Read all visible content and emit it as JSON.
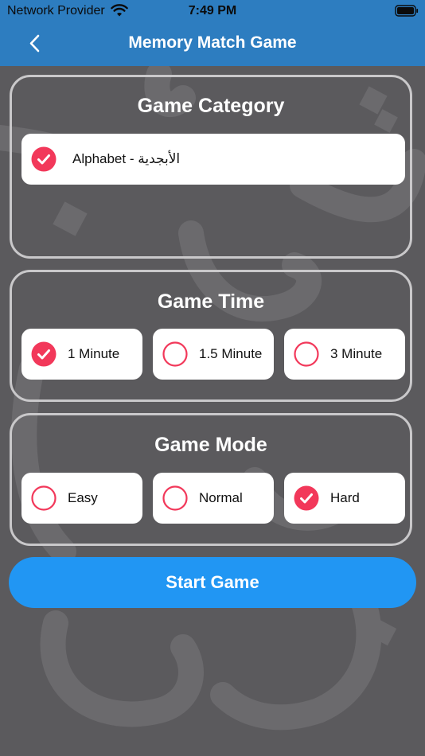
{
  "status": {
    "carrier": "Network Provider",
    "time": "7:49 PM"
  },
  "nav": {
    "title": "Memory Match Game",
    "back_icon": "chevron-left-icon"
  },
  "colors": {
    "header": "#2d7dc0",
    "background": "#5b5a5d",
    "accent_red": "#f2385a",
    "button_blue": "#2196f3"
  },
  "category": {
    "title": "Game Category",
    "options": [
      {
        "label": "Alphabet - الأبجدية",
        "selected": true
      }
    ]
  },
  "time": {
    "title": "Game Time",
    "options": [
      {
        "label": "1 Minute",
        "selected": true
      },
      {
        "label": "1.5 Minute",
        "selected": false
      },
      {
        "label": "3 Minute",
        "selected": false
      }
    ]
  },
  "mode": {
    "title": "Game Mode",
    "options": [
      {
        "label": "Easy",
        "selected": false
      },
      {
        "label": "Normal",
        "selected": false
      },
      {
        "label": "Hard",
        "selected": true
      }
    ]
  },
  "start_button": {
    "label": "Start Game"
  }
}
